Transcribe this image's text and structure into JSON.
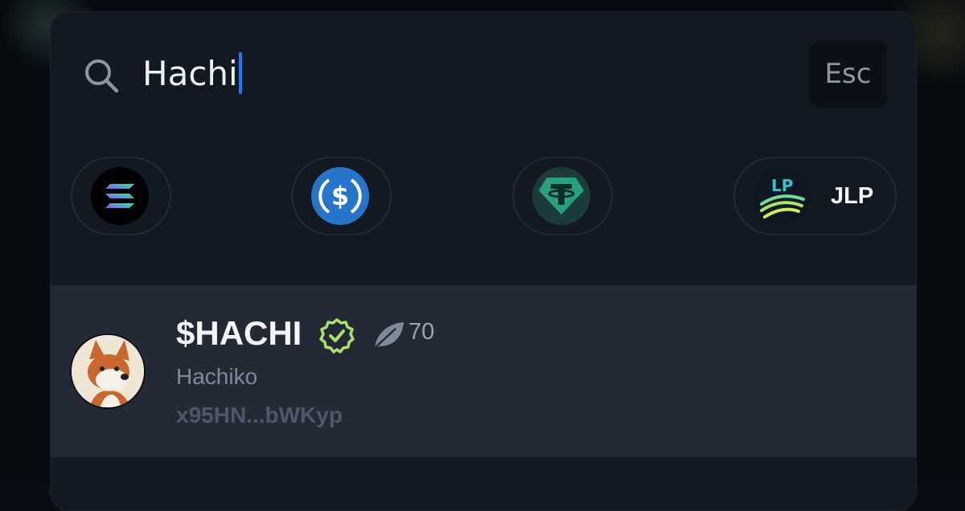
{
  "search": {
    "value": "Hachi",
    "esc_label": "Esc"
  },
  "quick_tokens": [
    {
      "icon": "solana-icon",
      "label": ""
    },
    {
      "icon": "usdc-icon",
      "label": ""
    },
    {
      "icon": "usdt-icon",
      "label": ""
    },
    {
      "icon": "jlp-icon",
      "label": "JLP",
      "icon_text": "LP"
    }
  ],
  "results": [
    {
      "avatar": "shiba-dog-avatar",
      "symbol": "$HACHI",
      "verified_icon": "verified-badge-icon",
      "score_icon": "leaf-icon",
      "score": "70",
      "name": "Hachiko",
      "address": "x95HN...bWKyp"
    }
  ],
  "colors": {
    "accent": "#1f7cf0",
    "verified": "#a8e26a",
    "row_bg": "#232a36",
    "modal_bg": "#121923"
  }
}
